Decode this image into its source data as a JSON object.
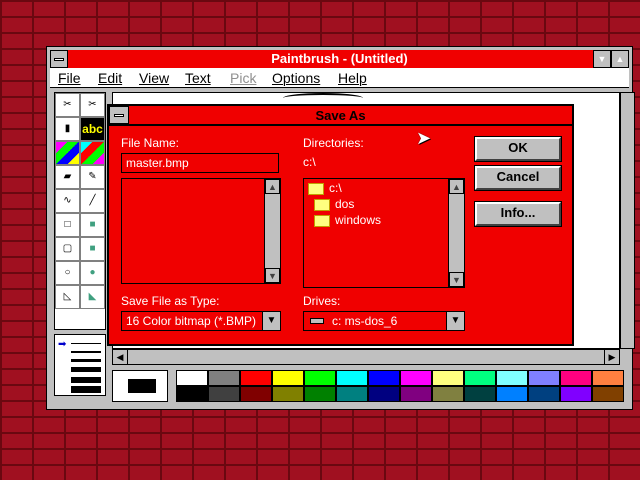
{
  "window": {
    "title": "Paintbrush - (Untitled)",
    "menus": [
      {
        "label": "File",
        "enabled": true
      },
      {
        "label": "Edit",
        "enabled": true
      },
      {
        "label": "View",
        "enabled": true
      },
      {
        "label": "Text",
        "enabled": true
      },
      {
        "label": "Pick",
        "enabled": false
      },
      {
        "label": "Options",
        "enabled": true
      },
      {
        "label": "Help",
        "enabled": true
      }
    ],
    "minimize_glyph": "▼",
    "maximize_glyph": "▲"
  },
  "toolbox": {
    "text_tool_label": "abc",
    "tools": [
      "scissors-icon",
      "pick-icon",
      "airbrush-icon",
      "text-icon",
      "color-eraser-icon",
      "eraser-icon",
      "paint-roller-icon",
      "brush-icon",
      "curve-icon",
      "line-icon",
      "box-icon",
      "filled-box-icon",
      "rounded-box-icon",
      "filled-rounded-box-icon",
      "circle-icon",
      "filled-circle-icon",
      "polygon-icon",
      "filled-polygon-icon"
    ]
  },
  "palette": {
    "colors_top": [
      "#ffffff",
      "#808080",
      "#ff0000",
      "#ffff00",
      "#00ff00",
      "#00ffff",
      "#0000ff",
      "#ff00ff",
      "#ffff80",
      "#00ff80",
      "#80ffff",
      "#8080ff",
      "#ff0080",
      "#ff8040"
    ],
    "colors_bottom": [
      "#000000",
      "#404040",
      "#800000",
      "#808000",
      "#008000",
      "#008080",
      "#000080",
      "#800080",
      "#808040",
      "#004040",
      "#0080ff",
      "#004080",
      "#8000ff",
      "#804000"
    ]
  },
  "dialog": {
    "title": "Save As",
    "file_name_label": "File Name:",
    "file_name_value": "master.bmp",
    "directories_label": "Directories:",
    "current_dir": "c:\\",
    "dir_items": [
      {
        "label": "c:\\",
        "icon": "open-folder-icon"
      },
      {
        "label": "dos",
        "icon": "folder-icon"
      },
      {
        "label": "windows",
        "icon": "folder-icon"
      }
    ],
    "save_type_label": "Save File as Type:",
    "save_type_value": "16 Color bitmap (*.BMP)",
    "drives_label": "Drives:",
    "drives_value": "c: ms-dos_6",
    "ok_label": "OK",
    "cancel_label": "Cancel",
    "info_label": "Info...",
    "scroll_up_glyph": "▲",
    "scroll_down_glyph": "▼",
    "combo_glyph": "▼"
  }
}
